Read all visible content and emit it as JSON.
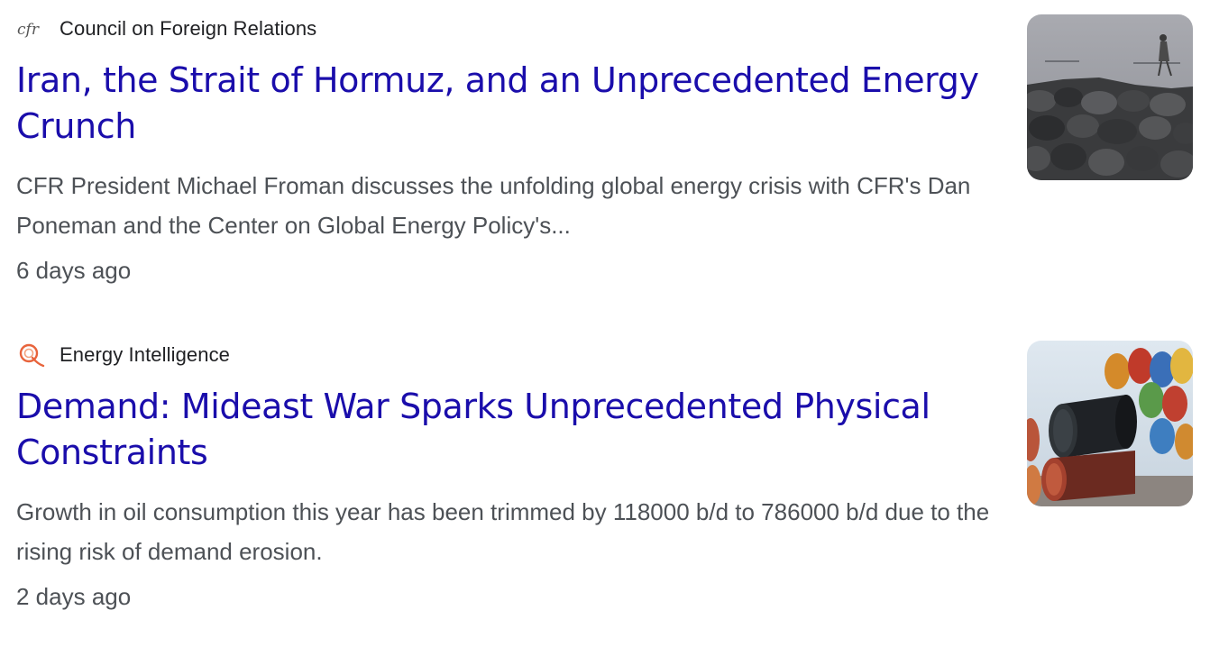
{
  "results": [
    {
      "source": "Council on Foreign Relations",
      "favicon_icon": "cfr-logo-icon",
      "favicon_text": "cfr",
      "title": "Iran, the Strait of Hormuz, and an Unprecedented Energy Crunch",
      "snippet": "CFR President Michael Froman discusses the unfolding global energy crisis with CFR's Dan Poneman and the Center on Global Energy Policy's...",
      "time": "6 days ago",
      "thumbnail_icon": "rocky-shore-thumbnail"
    },
    {
      "source": "Energy Intelligence",
      "favicon_icon": "energy-intelligence-logo-icon",
      "title": "Demand: Mideast War Sparks Unprecedented Physical Constraints",
      "snippet": "Growth in oil consumption this year has been trimmed by 118000 b/d to 786000 b/d due to the rising risk of demand erosion.",
      "time": "2 days ago",
      "thumbnail_icon": "oil-barrels-thumbnail"
    }
  ],
  "colors": {
    "link": "#1a0dab",
    "snippet": "#4d5156",
    "source": "#202124",
    "energy_logo": "#e8643c"
  }
}
